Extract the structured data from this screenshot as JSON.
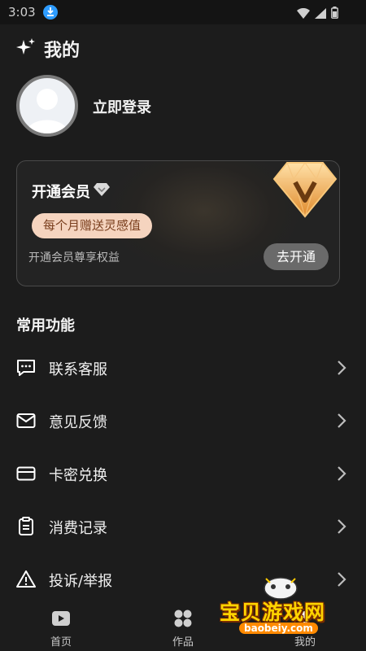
{
  "status_bar": {
    "time": "3:03"
  },
  "header": {
    "title": "我的"
  },
  "profile": {
    "login_label": "立即登录"
  },
  "vip_card": {
    "title": "开通会员",
    "badge": "每个月赠送灵感值",
    "description": "开通会员尊享权益",
    "open_button": "去开通"
  },
  "common_functions": {
    "title": "常用功能",
    "items": [
      {
        "label": "联系客服",
        "icon": "chat-bubble-icon"
      },
      {
        "label": "意见反馈",
        "icon": "mail-icon"
      },
      {
        "label": "卡密兑换",
        "icon": "card-icon"
      },
      {
        "label": "消费记录",
        "icon": "clipboard-icon"
      },
      {
        "label": "投诉/举报",
        "icon": "warning-icon"
      }
    ]
  },
  "bottom_nav": {
    "items": [
      {
        "label": "首页",
        "icon": "play-video-icon"
      },
      {
        "label": "作品",
        "icon": "grid-icon"
      },
      {
        "label": "我的",
        "icon": "user-icon",
        "active": true
      }
    ]
  },
  "watermark": {
    "text": "宝贝游戏网",
    "url": "baobeiy.com"
  },
  "colors": {
    "background": "#1c1c1c",
    "badge_bg": "#f5d4bf",
    "badge_text": "#7a3f1e",
    "button_bg": "#6a6a6a"
  }
}
